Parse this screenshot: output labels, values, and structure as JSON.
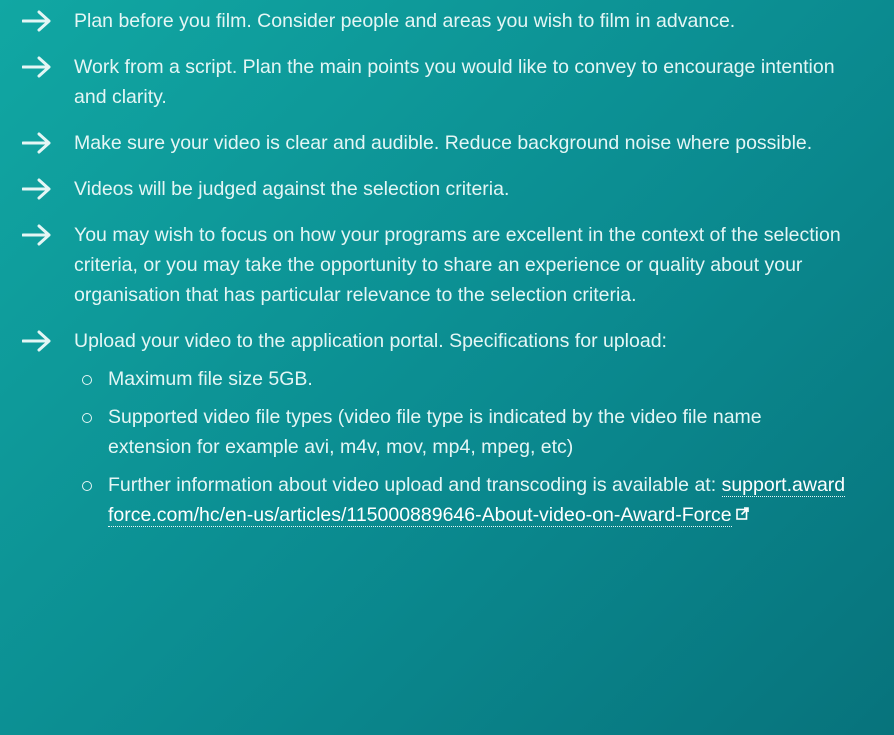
{
  "tips": [
    {
      "text": "Plan before you film. Consider people and areas you wish to film in advance."
    },
    {
      "text": "Work from a script. Plan the main points you would like to convey to encourage intention and clarity."
    },
    {
      "text": "Make sure your video is clear and audible. Reduce background noise where possible."
    },
    {
      "text": "Videos will be judged against the selection criteria."
    },
    {
      "text": "You may wish to focus on how your programs are excellent in the context of the selection criteria, or you may take the opportunity to share an experience or quality about your organisation that has particular relevance to the selection criteria."
    },
    {
      "text": "Upload your video to the application portal. Specifications for upload:"
    }
  ],
  "specs": [
    {
      "text": "Maximum file size 5GB."
    },
    {
      "text": "Supported video file types (video file type is indicated by the video file name extension for example avi, m4v, mov, mp4, mpeg, etc)"
    },
    {
      "text": "Further information about video upload and transcoding is available at:"
    }
  ],
  "link": {
    "text": "support.awardforce.com/hc/en-us/articles/115000889646-About-video-on-Award-Force"
  },
  "colors": {
    "background_start": "#11a7a3",
    "background_end": "#07737c",
    "text": "#e4f6f5",
    "link": "#ffffff"
  },
  "icons": {
    "tip_marker": "arrow-right-icon",
    "spec_marker": "circle-bullet-icon",
    "link_marker": "external-link-icon"
  }
}
